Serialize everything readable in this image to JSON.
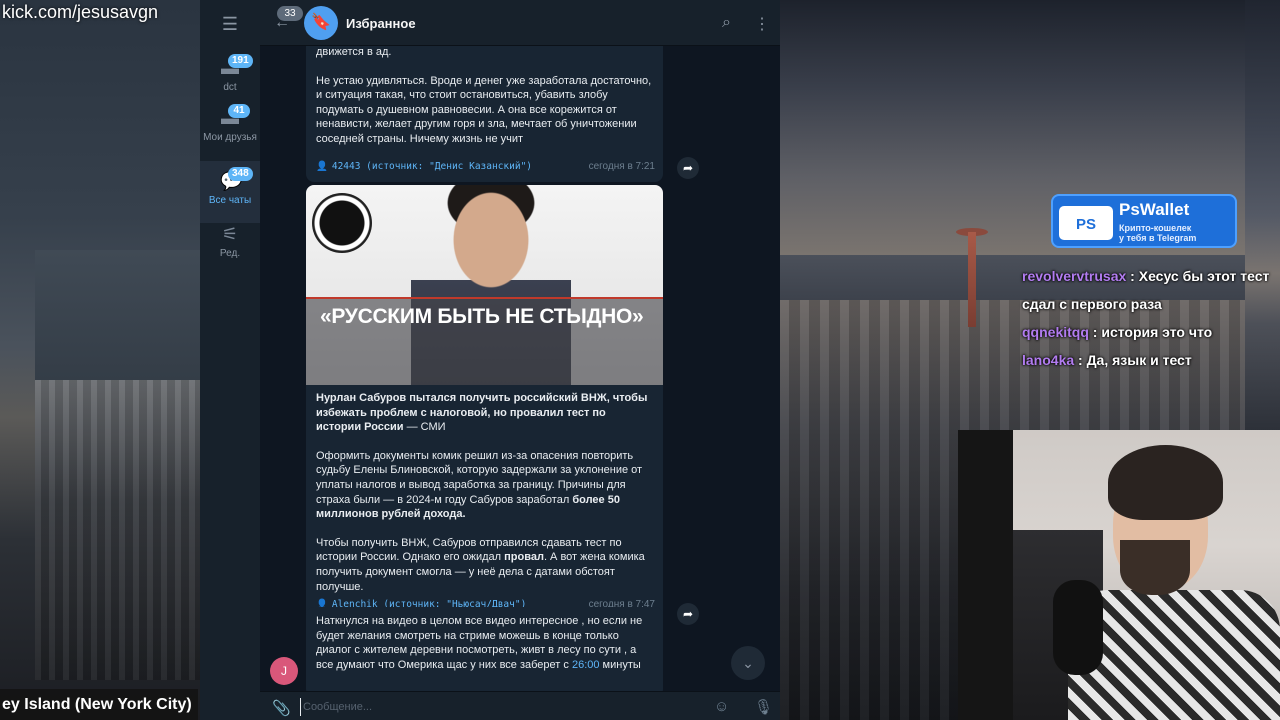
{
  "stream": {
    "channel_url": "kick.com/jesusavgn",
    "location": "ey Island (New York City)",
    "sponsor": {
      "logo": "PS",
      "title": "PsWallet",
      "subtitle_line1": "Крипто-кошелек",
      "subtitle_line2": "у тебя в Telegram"
    },
    "chat": [
      {
        "nick": "revolvervtrusax",
        "text": " : Хесус бы этот тест сдал с первого раза"
      },
      {
        "nick": "qqnekitqq",
        "text": " : история это что"
      },
      {
        "nick": "lano4ka",
        "text": " : Да, язык и тест"
      }
    ]
  },
  "telegram": {
    "folders": [
      {
        "label": "dct",
        "badge": "191",
        "icon": "folder-icon"
      },
      {
        "label": "Мои друзья",
        "badge": "41",
        "icon": "folder-icon"
      },
      {
        "label": "Все чаты",
        "badge": "348",
        "icon": "chats-icon",
        "active": true
      },
      {
        "label": "Ред.",
        "badge": "",
        "icon": "sliders-icon"
      }
    ],
    "header": {
      "back_badge": "33",
      "title": "Избранное"
    },
    "messages": [
      {
        "text_top": "движется в ад.",
        "text": "Не устаю удивляться. Вроде и денег уже заработала достаточно, и ситуация такая, что стоит остановиться, убавить злобу подумать о душевном равновесии. А она все корежится от ненависти, желает другим горя и зла, мечтает об уничтожении соседней страны. Ничему жизнь не учит",
        "author": "42443 (источник: \"Денис Казанский\")",
        "time": "сегодня в 7:21"
      },
      {
        "image_headline": "«РУССКИМ БЫТЬ НЕ СТЫДНО»",
        "title": "Нурлан Сабуров пытался получить российский ВНЖ, чтобы избежать проблем с налоговой, но провалил тест по истории России",
        "title_suffix": " — СМИ",
        "p1_start": "Оформить документы комик решил из-за опасения повторить судьбу Елены Блиновской, которую задержали за уклонение от уплаты налогов и вывод заработка за границу. Причины для страха были — в 2024-м году Сабуров заработал ",
        "p1_bold": "более 50 миллионов рублей дохода.",
        "p2_start": "Чтобы получить ВНЖ, Сабуров отправился сдавать тест по истории России. Однако его ожидал ",
        "p2_bold": "провал",
        "p2_end": ". А вот жена комика получить документ смогла — у неё дела с датами обстоят получше.",
        "author": "Alenchik (источник: \"Ньюсач/Двач\")",
        "time": "сегодня в 7:47"
      },
      {
        "avatar_letter": "J",
        "text": "Наткнулся на видео в целом все видео интересное , но если не будет желания смотреть на стриме можешь в конце только диалог с жителем деревни посмотреть, живт в лесу по сути , а все думают что Омерика щас у них все заберет с ",
        "link": "26:00",
        "text_end": " минуты"
      }
    ],
    "composer": {
      "placeholder": "Сообщение..."
    }
  }
}
